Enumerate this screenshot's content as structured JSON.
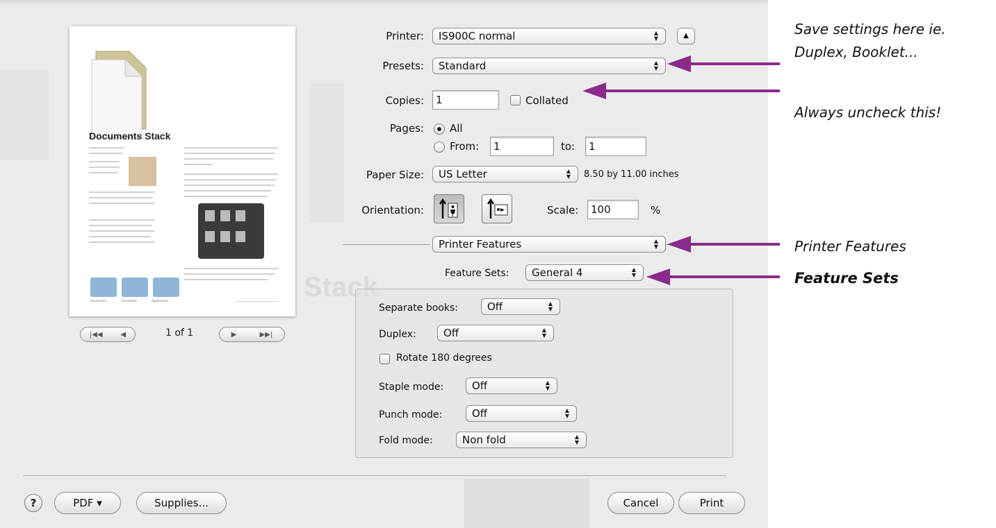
{
  "preview": {
    "doc_heading": "Documents Stack",
    "page_indicator": "1 of 1",
    "folder_labels": [
      "Documents",
      "Downloads",
      "Applications"
    ]
  },
  "background": {
    "ghost_word": "Stack"
  },
  "form": {
    "printer": {
      "label": "Printer:",
      "value": "IS900C normal"
    },
    "presets": {
      "label": "Presets:",
      "value": "Standard"
    },
    "copies": {
      "label": "Copies:",
      "value": "1",
      "collated_label": "Collated"
    },
    "pages": {
      "label": "Pages:",
      "all_label": "All",
      "from_label": "From:",
      "from_value": "1",
      "to_label": "to:",
      "to_value": "1"
    },
    "paper_size": {
      "label": "Paper Size:",
      "value": "US Letter",
      "dimensions": "8.50 by 11.00 inches"
    },
    "orientation": {
      "label": "Orientation:"
    },
    "scale": {
      "label": "Scale:",
      "value": "100",
      "unit": "%"
    },
    "panel": {
      "value": "Printer Features"
    },
    "feature_sets": {
      "label": "Feature Sets:",
      "value": "General 4"
    },
    "separate_books": {
      "label": "Separate books:",
      "value": "Off"
    },
    "duplex": {
      "label": "Duplex:",
      "value": "Off"
    },
    "rotate": {
      "label": "Rotate 180 degrees"
    },
    "staple": {
      "label": "Staple mode:",
      "value": "Off"
    },
    "punch": {
      "label": "Punch mode:",
      "value": "Off"
    },
    "fold": {
      "label": "Fold mode:",
      "value": "Non fold"
    }
  },
  "footer": {
    "help": "?",
    "pdf": "PDF ▾",
    "supplies": "Supplies...",
    "cancel": "Cancel",
    "print": "Print"
  },
  "annotations": {
    "presets_note_1": "Save settings here ie.",
    "presets_note_2": "Duplex, Booklet...",
    "collated_note": "Always uncheck this!",
    "features_note": "Printer Features",
    "feature_sets_note": "Feature Sets"
  },
  "colors": {
    "arrow": "#8a2a8a",
    "dialog_bg": "#ebebeb"
  }
}
